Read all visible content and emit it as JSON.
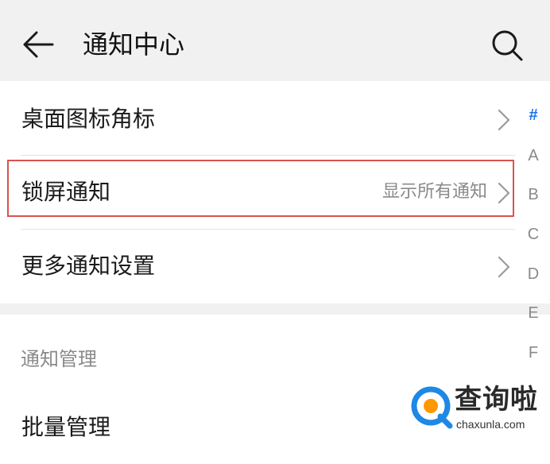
{
  "header": {
    "back_icon": "arrow-left-icon",
    "title": "通知中心",
    "search_icon": "search-icon"
  },
  "rows": [
    {
      "label": "桌面图标角标",
      "value": "",
      "chevron_icon": "chevron-right-icon"
    },
    {
      "label": "锁屏通知",
      "value": "显示所有通知",
      "chevron_icon": "chevron-right-icon",
      "highlighted": true
    },
    {
      "label": "更多通知设置",
      "value": "",
      "chevron_icon": "chevron-right-icon"
    }
  ],
  "section": {
    "title": "通知管理",
    "rows": [
      {
        "label": "批量管理"
      }
    ]
  },
  "alpha_index": {
    "active": "#",
    "letters": [
      "#",
      "A",
      "B",
      "C",
      "D",
      "E",
      "F"
    ]
  },
  "watermark": {
    "name": "查询啦",
    "domain": "chaxunla.com"
  },
  "colors": {
    "accent": "#1a73e8",
    "highlight_border": "#d9534f",
    "header_bg": "#f1f1f1",
    "secondary_text": "#8a8a8a"
  }
}
